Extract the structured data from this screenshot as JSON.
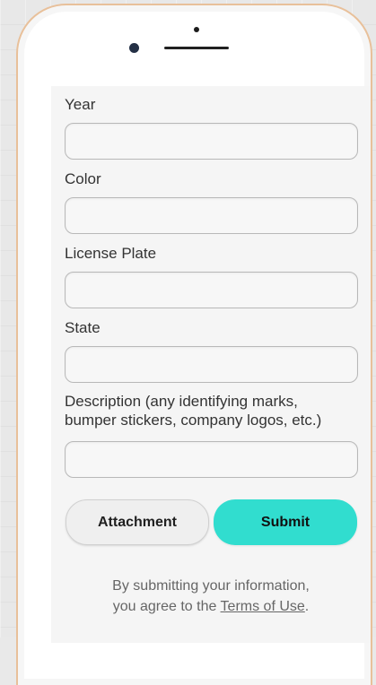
{
  "form": {
    "fields": [
      {
        "label": "Year",
        "value": "",
        "placeholder": ""
      },
      {
        "label": "Color",
        "value": "",
        "placeholder": ""
      },
      {
        "label": "License Plate",
        "value": "",
        "placeholder": ""
      },
      {
        "label": "State",
        "value": "",
        "placeholder": ""
      },
      {
        "label": "Description (any identifying marks, bumper stickers, company logos, etc.)",
        "value": "",
        "placeholder": ""
      }
    ]
  },
  "actions": {
    "attachment_label": "Attachment",
    "submit_label": "Submit"
  },
  "legal": {
    "line1": "By submitting your information,",
    "line2_prefix": "you agree to the ",
    "terms_link": "Terms of Use",
    "line2_suffix": "."
  },
  "colors": {
    "submit": "#31DDCF",
    "frame": "#E8C09A"
  }
}
